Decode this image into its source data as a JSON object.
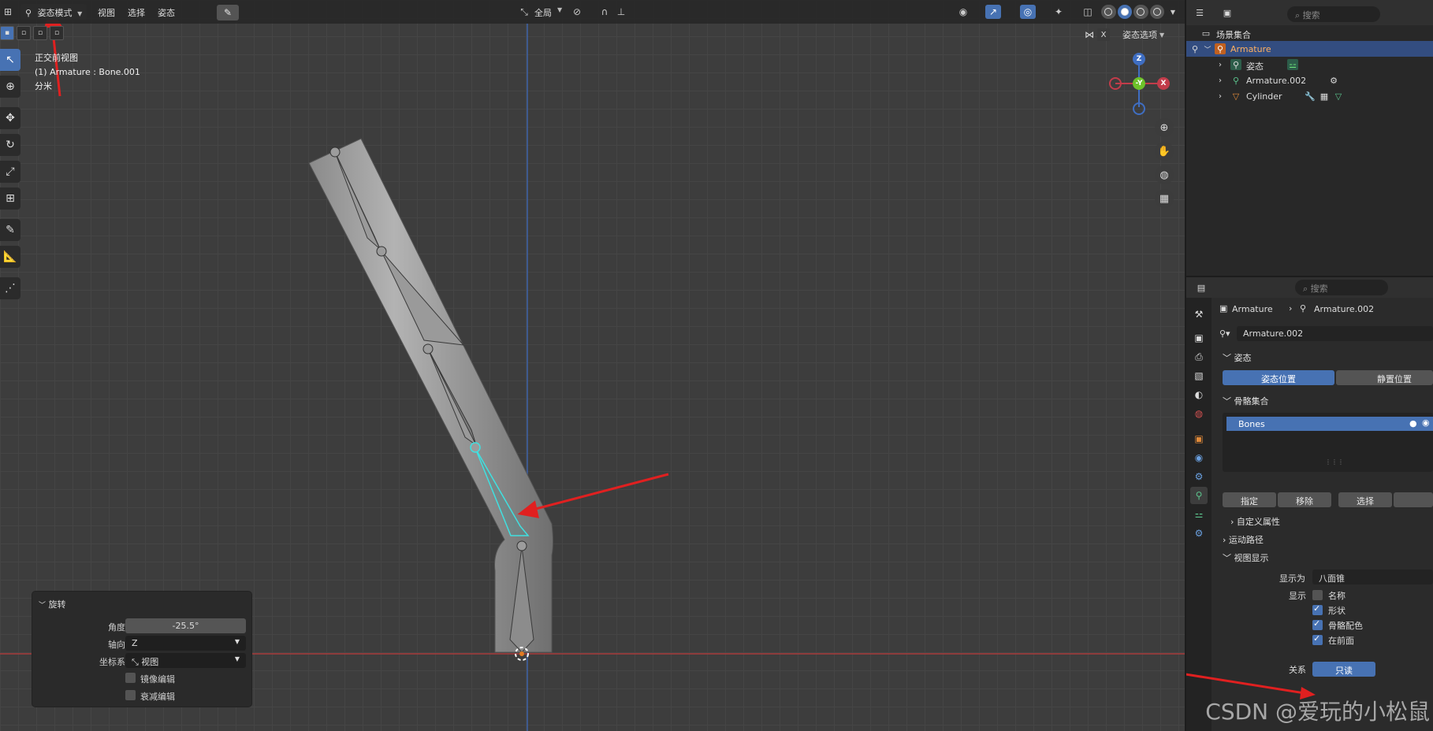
{
  "header": {
    "mode_label": "姿态模式",
    "menu": [
      "视图",
      "选择",
      "姿态"
    ],
    "transform_orientation": "全局"
  },
  "pose_options": "姿态选项",
  "overlay": {
    "view_name": "正交前视图",
    "active": "(1) Armature : Bone.001",
    "unit": "分米"
  },
  "gizmo": {
    "z": "Z",
    "y": "-Y",
    "x": "X"
  },
  "redo_panel": {
    "title": "旋转",
    "angle_label": "角度",
    "angle_value": "-25.5°",
    "axis_label": "轴向",
    "axis_value": "Z",
    "orient_label": "坐标系",
    "orient_value": "视图",
    "mirror_label": "镜像编辑",
    "proportional_label": "衰减编辑"
  },
  "outliner": {
    "search_placeholder": "搜索",
    "scene_collection": "场景集合",
    "items": [
      {
        "label": "Armature",
        "selected": true
      },
      {
        "label": "姿态"
      },
      {
        "label": "Armature.002"
      },
      {
        "label": "Cylinder"
      }
    ]
  },
  "properties": {
    "search_placeholder": "搜索",
    "breadcrumb_object": "Armature",
    "breadcrumb_data": "Armature.002",
    "data_name": "Armature.002",
    "pose_section": "姿态",
    "pose_position_btn": "姿态位置",
    "rest_position_btn": "静置位置",
    "bone_collections_section": "骨骼集合",
    "bone_collection_item": "Bones",
    "assign_btn": "指定",
    "remove_btn": "移除",
    "select_btn": "选择",
    "custom_props": "自定义属性",
    "motion_paths": "运动路径",
    "viewport_display": "视图显示",
    "display_as_label": "显示为",
    "display_as_value": "八面锥",
    "show_label": "显示",
    "show_name": "名称",
    "show_shape": "形状",
    "show_bone_colors": "骨骼配色",
    "show_in_front": "在前面",
    "relation_label": "关系",
    "relation_value": "只读"
  },
  "watermark": "CSDN @爱玩的小松鼠",
  "colors": {
    "accent": "#4772b3",
    "selection": "#334d80",
    "annotation_arrow": "#e02020",
    "active_bone": "#40e0e0"
  }
}
